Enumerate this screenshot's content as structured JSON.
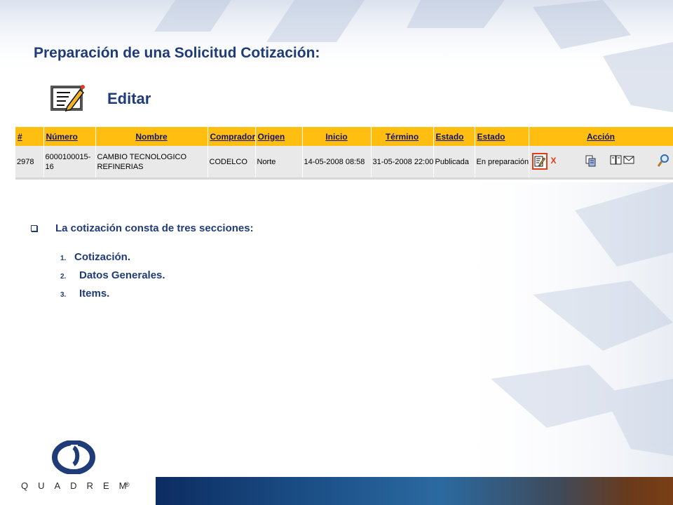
{
  "slide": {
    "title": "Preparación de una Solicitud Cotización:",
    "edit_label": "Editar"
  },
  "table": {
    "headers": [
      "#",
      "Número",
      "Nombre",
      "Comprador",
      "Origen",
      "Inicio",
      "Término",
      "Estado",
      "Estado",
      "Acción"
    ],
    "row": {
      "id": "2978",
      "numero": "6000100015-16",
      "nombre": "CAMBIO TECNOLOGICO REFINERIAS",
      "comprador": "CODELCO",
      "origen": "Norte",
      "inicio": "14-05-2008 08:58",
      "termino": "31-05-2008 22:00",
      "estado1": "Publicada",
      "estado2": "En preparación",
      "actions": [
        {
          "icon": "edit-icon",
          "highlighted": true
        },
        {
          "icon": "delete-x-icon",
          "label": "X"
        },
        {
          "icon": "copy-document-icon"
        },
        {
          "icon": "book-icon"
        },
        {
          "icon": "mail-envelope-icon"
        },
        {
          "icon": "magnifier-search-icon"
        }
      ]
    }
  },
  "content": {
    "bullet": "La cotización consta de tres secciones:",
    "list": [
      {
        "marker": "1.",
        "text": "Cotización."
      },
      {
        "marker": "2.",
        "text": "Datos Generales."
      },
      {
        "marker": "3.",
        "text": "Items."
      }
    ]
  },
  "footer": {
    "logo_text": "QUADREM",
    "logo_symbol": "®"
  },
  "colors": {
    "title_blue": "#1f3c78",
    "header_orange": "#ffbe10",
    "highlight_red": "#e23b16",
    "row_gray": "#e9e9e9"
  }
}
